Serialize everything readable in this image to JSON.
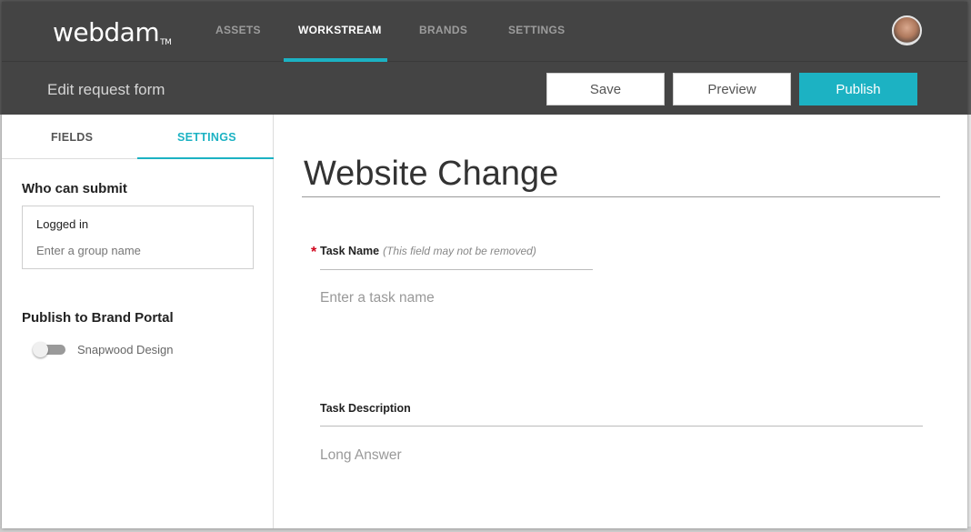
{
  "app": {
    "logo_text": "webdam",
    "logo_tm": "TM"
  },
  "nav": {
    "tabs": [
      {
        "label": "ASSETS",
        "active": false
      },
      {
        "label": "WORKSTREAM",
        "active": true
      },
      {
        "label": "BRANDS",
        "active": false
      },
      {
        "label": "SETTINGS",
        "active": false
      }
    ]
  },
  "subbar": {
    "title": "Edit request form",
    "save_label": "Save",
    "preview_label": "Preview",
    "publish_label": "Publish"
  },
  "left_panel": {
    "tabs": [
      {
        "label": "FIELDS",
        "active": false
      },
      {
        "label": "SETTINGS",
        "active": true
      }
    ],
    "who_can_submit": {
      "title": "Who can submit",
      "value": "Logged in",
      "placeholder": "Enter a group name"
    },
    "publish_brand_portal": {
      "title": "Publish to Brand Portal",
      "toggle_label": "Snapwood Design",
      "enabled": false
    }
  },
  "form": {
    "title": "Website Change",
    "fields": [
      {
        "label": "Task Name",
        "note": "(This field may not be removed)",
        "required": true,
        "placeholder": "Enter a task name"
      },
      {
        "label": "Task Description",
        "note": "",
        "required": false,
        "placeholder": "Long Answer"
      }
    ]
  },
  "colors": {
    "accent": "#1cb2c3",
    "header_bg": "#444444",
    "required": "#d0021b"
  }
}
